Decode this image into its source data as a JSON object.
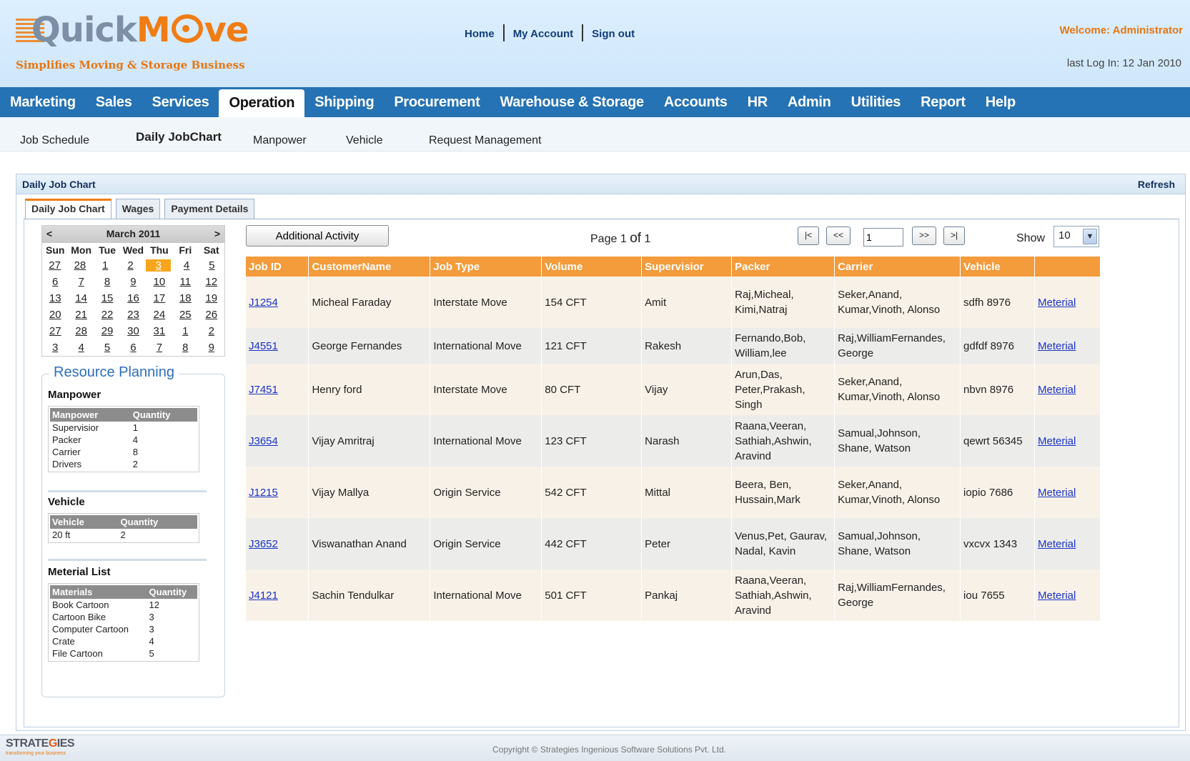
{
  "brand": {
    "name_part1": "Quick",
    "name_part2": "M",
    "name_part3": "ve",
    "tagline": "Simplifies Moving & Storage Business"
  },
  "toplinks": [
    "Home",
    "My Account",
    "Sign out"
  ],
  "welcome": "Welcome: Administrator",
  "last_login": "last Log In: 12 Jan 2010",
  "mainnav": [
    "Marketing",
    "Sales",
    "Services",
    "Operation",
    "Shipping",
    "Procurement",
    "Warehouse & Storage",
    "Accounts",
    "HR",
    "Admin",
    "Utilities",
    "Report",
    "Help"
  ],
  "mainnav_active": "Operation",
  "subnav": [
    "Job Schedule",
    "Daily JobChart",
    "Manpower",
    "Vehicle",
    "Request Management"
  ],
  "subnav_active": "Daily JobChart",
  "panel": {
    "title": "Daily Job Chart",
    "refresh": "Refresh"
  },
  "tabs": [
    "Daily Job Chart",
    "Wages",
    "Payment Details"
  ],
  "calendar": {
    "prev": "<",
    "next": ">",
    "month": "March 2011",
    "dow": [
      "Sun",
      "Mon",
      "Tue",
      "Wed",
      "Thu",
      "Fri",
      "Sat"
    ],
    "weeks": [
      [
        "27",
        "28",
        "1",
        "2",
        "3",
        "4",
        "5"
      ],
      [
        "6",
        "7",
        "8",
        "9",
        "10",
        "11",
        "12"
      ],
      [
        "13",
        "14",
        "15",
        "16",
        "17",
        "18",
        "19"
      ],
      [
        "20",
        "21",
        "22",
        "23",
        "24",
        "25",
        "26"
      ],
      [
        "27",
        "28",
        "29",
        "30",
        "31",
        "1",
        "2"
      ],
      [
        "3",
        "4",
        "5",
        "6",
        "7",
        "8",
        "9"
      ]
    ],
    "today": "3"
  },
  "resource": {
    "title": "Resource Planning",
    "manpower": {
      "heading": "Manpower",
      "cols": [
        "Manpower",
        "Quantity"
      ],
      "rows": [
        [
          "Supervisior",
          "1"
        ],
        [
          "Packer",
          "4"
        ],
        [
          "Carrier",
          "8"
        ],
        [
          "Drivers",
          "2"
        ]
      ]
    },
    "vehicle": {
      "heading": "Vehicle",
      "cols": [
        "Vehicle",
        "Quantity"
      ],
      "rows": [
        [
          "20 ft",
          "2"
        ]
      ]
    },
    "material": {
      "heading": "Meterial List",
      "cols": [
        "Materials",
        "Quantity"
      ],
      "rows": [
        [
          "Book Cartoon",
          "12"
        ],
        [
          "Cartoon Bike",
          "3"
        ],
        [
          "Computer Cartoon",
          "3"
        ],
        [
          "Crate",
          "4"
        ],
        [
          "File Cartoon",
          "5"
        ]
      ]
    }
  },
  "toolbar": {
    "additional": "Additional Activity",
    "page_label": "Page",
    "page_num": "1",
    "of_label": "of",
    "page_total": "1",
    "first": "|<",
    "prev": "<<",
    "page_input": "1",
    "next": ">>",
    "last": ">|",
    "show_label": "Show",
    "show_value": "10"
  },
  "grid": {
    "cols": [
      "Job ID",
      "CustomerName",
      "Job Type",
      "Volume",
      "Supervisior",
      "Packer",
      "Carrier",
      "Vehicle",
      ""
    ],
    "rows": [
      {
        "id": "J1254",
        "customer": "Micheal Faraday",
        "type": "Interstate Move",
        "volume": "154 CFT",
        "supervisor": "Amit",
        "packer": "Raj,Micheal, Kimi,Natraj",
        "carrier": "Seker,Anand, Kumar,Vinoth, Alonso",
        "vehicle": "sdfh 8976",
        "link": "Meterial"
      },
      {
        "id": "J4551",
        "customer": "George Fernandes",
        "type": "International Move",
        "volume": "121 CFT",
        "supervisor": "Rakesh",
        "packer": "Fernando,Bob, William,lee",
        "carrier": "Raj,WilliamFernandes, George",
        "vehicle": "gdfdf 8976",
        "link": "Meterial"
      },
      {
        "id": "J7451",
        "customer": "Henry ford",
        "type": "Interstate Move",
        "volume": "80 CFT",
        "supervisor": "Vijay",
        "packer": "Arun,Das, Peter,Prakash, Singh",
        "carrier": "Seker,Anand, Kumar,Vinoth, Alonso",
        "vehicle": "nbvn 8976",
        "link": "Meterial"
      },
      {
        "id": "J3654",
        "customer": "Vijay Amritraj",
        "type": "International Move",
        "volume": "123 CFT",
        "supervisor": "Narash",
        "packer": "Raana,Veeran, Sathiah,Ashwin, Aravind",
        "carrier": "Samual,Johnson, Shane, Watson",
        "vehicle": "qewrt 56345",
        "link": "Meterial"
      },
      {
        "id": "J1215",
        "customer": "Vijay Mallya",
        "type": "Origin Service",
        "volume": "542 CFT",
        "supervisor": "Mittal",
        "packer": "Beera, Ben, Hussain,Mark",
        "carrier": "Seker,Anand, Kumar,Vinoth, Alonso",
        "vehicle": "iopio 7686",
        "link": "Meterial"
      },
      {
        "id": "J3652",
        "customer": "Viswanathan Anand",
        "type": "Origin Service",
        "volume": "442 CFT",
        "supervisor": "Peter",
        "packer": "Venus,Pet, Gaurav, Nadal, Kavin",
        "carrier": "Samual,Johnson, Shane, Watson",
        "vehicle": "vxcvx 1343",
        "link": "Meterial"
      },
      {
        "id": "J4121",
        "customer": "Sachin Tendulkar",
        "type": "International Move",
        "volume": "501 CFT",
        "supervisor": "Pankaj",
        "packer": "Raana,Veeran, Sathiah,Ashwin, Aravind",
        "carrier": "Raj,WilliamFernandes, George",
        "vehicle": "iou 7655",
        "link": "Meterial"
      }
    ]
  },
  "footer": {
    "logo_a": "STRATE",
    "logo_g": "G",
    "logo_b": "IES",
    "sub": "transforming your business",
    "copyright": "Copyright © Strategies Ingenious Software Solutions Pvt. Ltd."
  },
  "colors": {
    "nav": "#2572b4",
    "accent": "#f07c14",
    "header": "#f49b3c"
  }
}
